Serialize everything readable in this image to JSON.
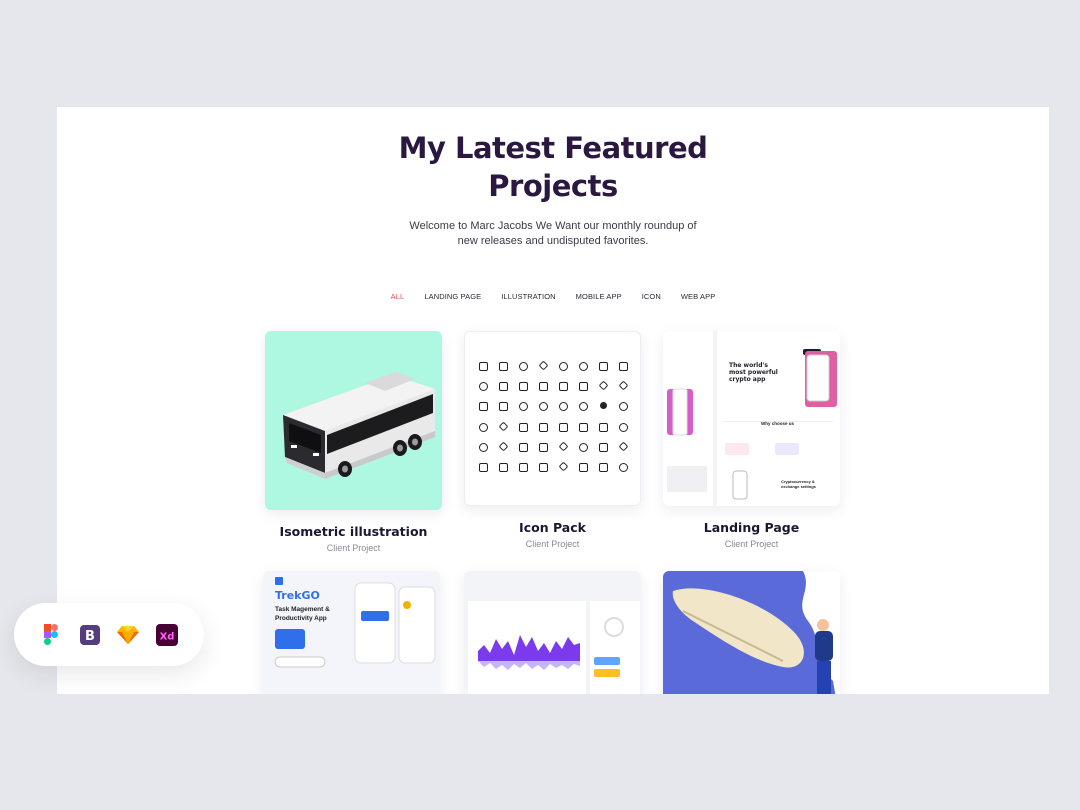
{
  "header": {
    "title_line1": "My Latest Featured",
    "title_line2": "Projects",
    "subtitle_line1": "Welcome to Marc Jacobs We Want our monthly roundup of",
    "subtitle_line2": "new releases and undisputed favorites."
  },
  "filters": [
    "ALL",
    "LANDING PAGE",
    "ILLUSTRATION",
    "MOBILE APP",
    "ICON",
    "WEB APP"
  ],
  "active_filter": "ALL",
  "projects": [
    {
      "title": "Isometric illustration",
      "subtitle": "Client Project"
    },
    {
      "title": "Icon Pack",
      "subtitle": "Client Project"
    },
    {
      "title": "Landing Page",
      "subtitle": "Client Project"
    }
  ],
  "landing_mock": {
    "headline_1": "The world's",
    "headline_2": "most powerful",
    "headline_3": "crypto app",
    "section": "Why choose us",
    "side_1": "Cryptocurrency &",
    "side_2": "exchange settings"
  },
  "trek_mock": {
    "brand": "TrekGO",
    "tagline_1": "Task Magement &",
    "tagline_2": "Productivity App"
  },
  "tools": [
    "figma-icon",
    "bootstrap-icon",
    "sketch-icon",
    "xd-icon"
  ],
  "colors": {
    "accent": "#ee4b5a",
    "title": "#2a1840",
    "bus_bg": "#aef7e0",
    "purple": "#7c3aed"
  }
}
